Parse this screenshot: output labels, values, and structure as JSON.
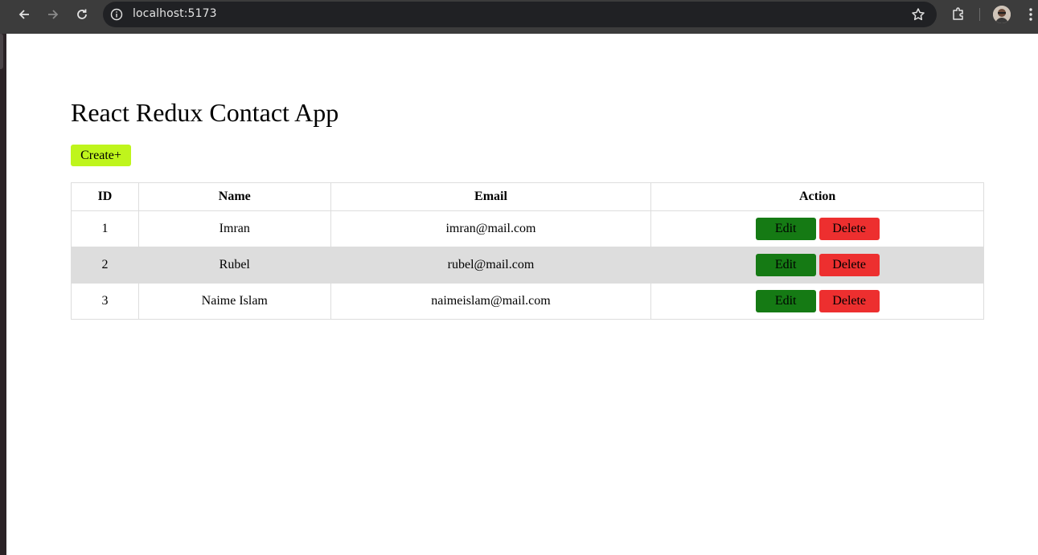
{
  "browser": {
    "url": "localhost:5173",
    "icons": [
      "back-arrow-icon",
      "forward-arrow-icon",
      "reload-icon",
      "site-info-icon",
      "bookmark-star-icon",
      "extensions-icon",
      "profile-avatar",
      "browser-menu-icon"
    ]
  },
  "app": {
    "title": "React Redux Contact App",
    "create_label": "Create+"
  },
  "table": {
    "headers": {
      "id": "ID",
      "name": "Name",
      "email": "Email",
      "action": "Action"
    },
    "rows": [
      {
        "id": "1",
        "name": "Imran",
        "email": "imran@mail.com",
        "edit": "Edit",
        "delete": "Delete"
      },
      {
        "id": "2",
        "name": "Rubel",
        "email": "rubel@mail.com",
        "edit": "Edit",
        "delete": "Delete"
      },
      {
        "id": "3",
        "name": "Naime Islam",
        "email": "naimeislam@mail.com",
        "edit": "Edit",
        "delete": "Delete"
      }
    ]
  },
  "colors": {
    "create_button": "#bff51c",
    "edit_button": "#157a14",
    "delete_button": "#ed2f2f",
    "striped_row": "#dddddd",
    "browser_chrome": "#3c3c3c"
  }
}
